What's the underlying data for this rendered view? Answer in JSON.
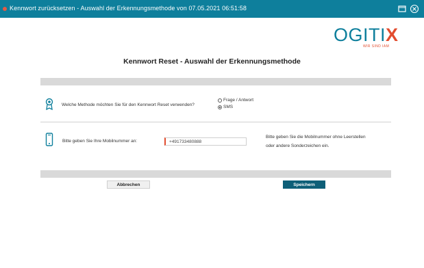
{
  "window": {
    "title": "Kennwort zurücksetzen - Auswahl der Erkennungsmethode von 07.05.2021 06:51:58",
    "maximize_icon": "maximize-icon",
    "close_icon": "close-circle-icon",
    "titlebar_color": "#0e7f9c"
  },
  "brand": {
    "name_main": "OGITI",
    "name_x": "X",
    "tagline": "WIR SIND IAM",
    "primary_color": "#0e7f9c",
    "accent_color": "#e24c2e"
  },
  "page": {
    "title": "Kennwort Reset - Auswahl der Erkennungsmethode"
  },
  "method": {
    "icon": "badge-icon",
    "question": "Welche Methode möchten Sie für den Kennwort Reset verwenden?",
    "options": [
      {
        "label": "Frage / Antwort",
        "selected": false
      },
      {
        "label": "SMS",
        "selected": true
      }
    ]
  },
  "mobile": {
    "icon": "phone-icon",
    "label": "Bitte geben Sie Ihre Mobilnummer an:",
    "value": "+491733480888",
    "hint": "Bitte geben Sie die Mobilnummer ohne Leerstellen oder andere Sonderzeichen ein."
  },
  "actions": {
    "cancel_label": "Abbrechen",
    "save_label": "Speichern",
    "save_color": "#0e5f78"
  }
}
